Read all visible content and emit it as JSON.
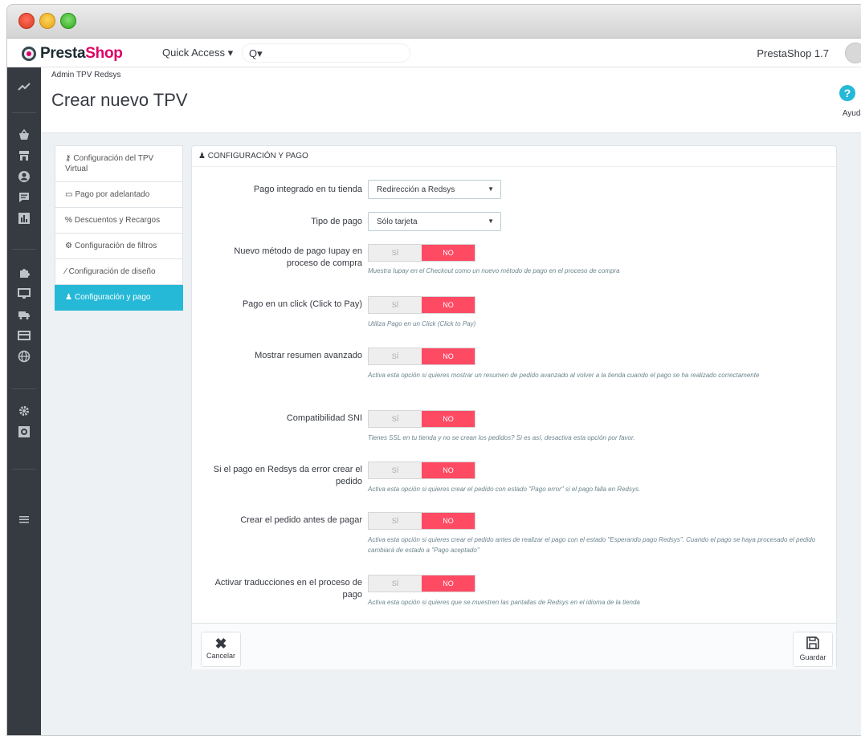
{
  "topbar": {
    "logo_prefix": "Presta",
    "logo_suffix": "Shop",
    "quick_access": "Quick Access ▾",
    "search": "Q▾",
    "version": "PrestaShop 1.7"
  },
  "header": {
    "breadcrumb": "Admin TPV Redsys",
    "title": "Crear nuevo TPV",
    "help": "Ayuda"
  },
  "tabs": [
    {
      "label": "Configuración del TPV Virtual",
      "icon": "key-icon"
    },
    {
      "label": "Pago por adelantado",
      "icon": "credit-card-icon"
    },
    {
      "label": "Descuentos y Recargos",
      "icon": "percent-icon"
    },
    {
      "label": "Configuración de filtros",
      "icon": "gears-icon"
    },
    {
      "label": "Configuración de diseño",
      "icon": "magic-wand-icon"
    },
    {
      "label": "Configuración y pago",
      "icon": "user-icon",
      "active": true
    }
  ],
  "panel": {
    "heading": "CONFIGURACIÓN Y PAGO",
    "fields": {
      "integrated": {
        "label": "Pago integrado en tu tienda",
        "value": "Redirección a Redsys"
      },
      "pay_type": {
        "label": "Tipo de pago",
        "value": "Sólo tarjeta"
      },
      "lupay": {
        "label": "Nuevo método de pago Iupay en proceso de compra",
        "hint": "Muestra Iupay en el Checkout como un nuevo método de pago en el proceso de compra"
      },
      "click_to_pay": {
        "label": "Pago en un click (Click to Pay)",
        "hint": "Utiliza Pago en un Click (Click to Pay)"
      },
      "resumen": {
        "label": "Mostrar resumen avanzado",
        "hint": "Activa esta opción si quieres mostrar un resumen de pedido avanzado al volver a la tienda cuando el pago se ha realizado correctamente"
      },
      "sni": {
        "label": "Compatibilidad SNI",
        "hint": "Tienes SSL en tu tienda y no se crean los pedidos? Si es así, desactiva esta opción por favor."
      },
      "error_order": {
        "label": "Si el pago en Redsys da error crear el pedido",
        "hint": "Activa esta opción si quieres crear el pedido con estado \"Pago error\" si el pago falla en Redsys."
      },
      "before_pay": {
        "label": "Crear el pedido antes de pagar",
        "hint": "Activa esta opción si quieres crear el pedido antes de realizar el pago con el estado \"Esperando pago Redsys\". Cuando el pago se haya procesado el pedido cambiará de estado a \"Pago aceptado\""
      },
      "translations": {
        "label": "Activar traducciones en el proceso de pago",
        "hint": "Activa esta opción si quieres que se muestren las pantallas de Redsys en el idioma de la tienda"
      }
    },
    "switch_yes": "SÍ",
    "switch_no": "NO",
    "cancel": "Cancelar",
    "save": "Guardar"
  },
  "colors": {
    "accent": "#25b9d7",
    "brand": "#df0067",
    "switch_off": "#fe4a63",
    "sidebar": "#363a41"
  }
}
